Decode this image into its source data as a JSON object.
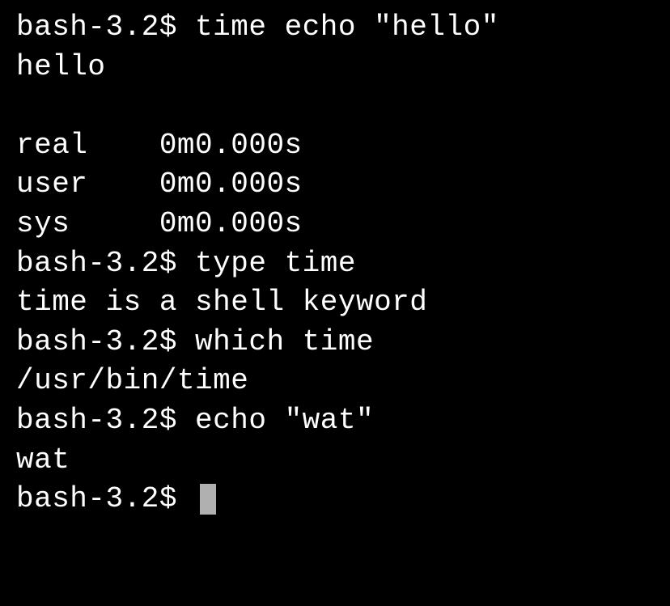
{
  "terminal": {
    "prompt": "bash-3.2$ ",
    "lines": [
      {
        "type": "command",
        "text": "time echo \"hello\""
      },
      {
        "type": "output",
        "text": "hello"
      },
      {
        "type": "blank",
        "text": ""
      },
      {
        "type": "output",
        "text": "real    0m0.000s"
      },
      {
        "type": "output",
        "text": "user    0m0.000s"
      },
      {
        "type": "output",
        "text": "sys     0m0.000s"
      },
      {
        "type": "command",
        "text": "type time"
      },
      {
        "type": "output",
        "text": "time is a shell keyword"
      },
      {
        "type": "command",
        "text": "which time"
      },
      {
        "type": "output",
        "text": "/usr/bin/time"
      },
      {
        "type": "command",
        "text": "echo \"wat\""
      },
      {
        "type": "output",
        "text": "wat"
      },
      {
        "type": "prompt",
        "text": ""
      }
    ]
  }
}
